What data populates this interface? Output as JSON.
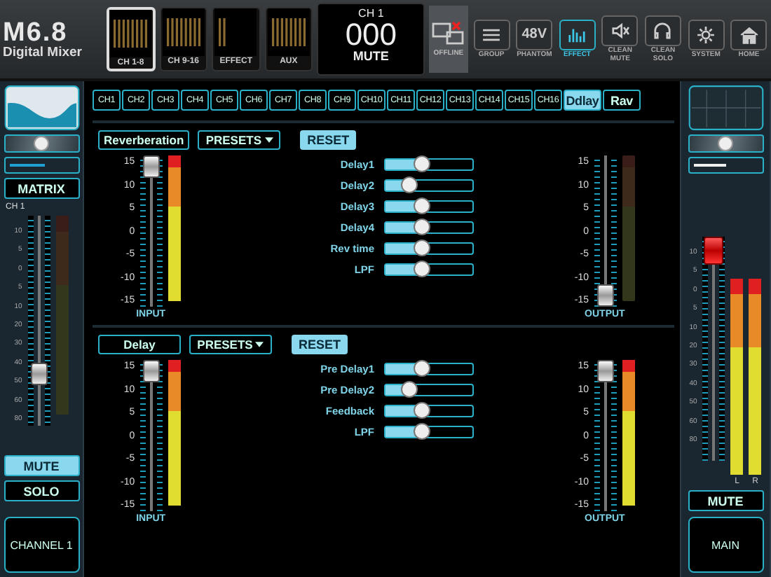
{
  "header": {
    "logo": {
      "title": "M6.8",
      "subtitle": "Digital Mixer"
    },
    "views": [
      {
        "label": "CH 1-8",
        "selected": true
      },
      {
        "label": "CH 9-16",
        "selected": false
      },
      {
        "label": "EFFECT",
        "selected": false
      },
      {
        "label": "AUX",
        "selected": false
      }
    ],
    "channel_display": {
      "label": "CH 1",
      "number": "000",
      "status": "MUTE"
    },
    "offline": {
      "label": "OFFLINE"
    },
    "toolbar": [
      {
        "kind": "group",
        "label": "GROUP",
        "selected": false
      },
      {
        "kind": "phantom",
        "icon_text": "48V",
        "label": "PHANTOM",
        "selected": false
      },
      {
        "kind": "effect",
        "label": "EFFECT",
        "selected": true
      },
      {
        "kind": "mute",
        "label": "CLEAN MUTE",
        "selected": false
      },
      {
        "kind": "solo",
        "label": "CLEAN SOLO",
        "selected": false
      },
      {
        "kind": "system",
        "label": "SYSTEM",
        "selected": false
      },
      {
        "kind": "home",
        "label": "HOME",
        "selected": false
      }
    ]
  },
  "left_strip": {
    "send": {
      "level": 0.55
    },
    "matrix": "MATRIX",
    "channel_label": "CH 1",
    "scale": [
      "10",
      "5",
      "0",
      "5",
      "10",
      "20",
      "30",
      "40",
      "50",
      "60",
      "80"
    ],
    "fader": {
      "level": 0.22
    },
    "meter": {
      "active": false
    },
    "buttons": [
      {
        "label": "MUTE",
        "selected": true
      },
      {
        "label": "SOLO",
        "selected": false
      }
    ],
    "name": "CHANNEL 1"
  },
  "channel_tabs": [
    {
      "label": "CH1",
      "selected": false
    },
    {
      "label": "CH2",
      "selected": false
    },
    {
      "label": "CH3",
      "selected": false
    },
    {
      "label": "CH4",
      "selected": false
    },
    {
      "label": "CH5",
      "selected": false
    },
    {
      "label": "CH6",
      "selected": false
    },
    {
      "label": "CH7",
      "selected": false
    },
    {
      "label": "CH8",
      "selected": false
    },
    {
      "label": "CH9",
      "selected": false
    },
    {
      "label": "CH10",
      "selected": false
    },
    {
      "label": "CH11",
      "selected": false
    },
    {
      "label": "CH12",
      "selected": false
    },
    {
      "label": "CH13",
      "selected": false
    },
    {
      "label": "CH14",
      "selected": false
    },
    {
      "label": "CH15",
      "selected": false
    },
    {
      "label": "CH16",
      "selected": false
    },
    {
      "label": "Ddlay",
      "selected": true
    },
    {
      "label": "Rav",
      "selected": false
    }
  ],
  "effects": [
    {
      "name": "Reverberation",
      "presets": "PRESETS",
      "reset": "RESET",
      "input": {
        "label": "INPUT",
        "scale": [
          "15",
          "10",
          "5",
          "0",
          "-5",
          "-10",
          "-15"
        ],
        "fader": {
          "level": 1
        },
        "meter": {
          "active": true,
          "level": 1
        }
      },
      "params": [
        {
          "name": "Delay1",
          "level": 0.42
        },
        {
          "name": "Delay2",
          "level": 0.28
        },
        {
          "name": "Delay3",
          "level": 0.42
        },
        {
          "name": "Delay4",
          "level": 0.42
        },
        {
          "name": "Rev time",
          "level": 0.42
        },
        {
          "name": "LPF",
          "level": 0.42
        }
      ],
      "output": {
        "label": "OUTPUT",
        "scale": [
          "15",
          "10",
          "5",
          "0",
          "-5",
          "-10",
          "-15"
        ],
        "fader": {
          "level": 0
        },
        "meter": {
          "active": false
        }
      }
    },
    {
      "name": "Delay",
      "presets": "PRESETS",
      "reset": "RESET",
      "input": {
        "label": "INPUT",
        "scale": [
          "15",
          "10",
          "5",
          "0",
          "-5",
          "-10",
          "-15"
        ],
        "fader": {
          "level": 1
        },
        "meter": {
          "active": true,
          "level": 1
        }
      },
      "params": [
        {
          "name": "Pre Delay1",
          "level": 0.42
        },
        {
          "name": "Pre Delay2",
          "level": 0.28
        },
        {
          "name": "Feedback",
          "level": 0.42
        },
        {
          "name": "LPF",
          "level": 0.42
        }
      ],
      "output": {
        "label": "OUTPUT",
        "scale": [
          "15",
          "10",
          "5",
          "0",
          "-5",
          "-10",
          "-15"
        ],
        "fader": {
          "level": 1
        },
        "meter": {
          "active": true,
          "level": 1
        }
      }
    }
  ],
  "right_strip": {
    "send": {
      "level": 0.5
    },
    "scale": [
      "10",
      "5",
      "0",
      "5",
      "10",
      "20",
      "30",
      "40",
      "50",
      "60",
      "80"
    ],
    "fader": {
      "level": 1
    },
    "meters": [
      {
        "label": "L",
        "active": true,
        "level": 1
      },
      {
        "label": "R",
        "active": true,
        "level": 1
      }
    ],
    "mute": {
      "label": "MUTE",
      "selected": false
    },
    "name": "MAIN"
  }
}
